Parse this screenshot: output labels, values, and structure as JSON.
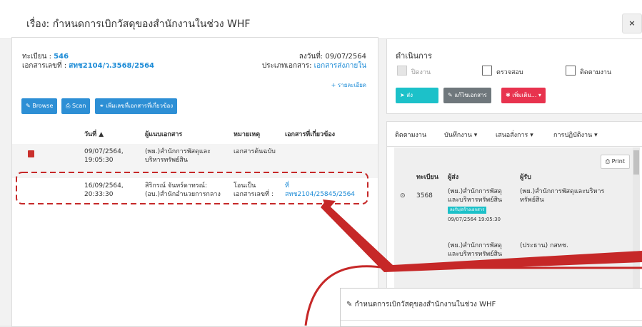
{
  "header": {
    "title": "เรื่อง: กำหนดการเบิกวัสดุของสำนักงานในช่วง WHF",
    "close_label": "×"
  },
  "doc": {
    "reg_label": "ทะเบียน :",
    "reg_value": "546",
    "docno_label": "เอกสารเลขที่ :",
    "docno_value": "สทช2104/ว.3568/2564",
    "date_label": "ลงวันที่:",
    "date_value": "09/07/2564",
    "type_label": "ประเภทเอกสาร:",
    "type_value": "เอกสารส่งภายใน",
    "detail_link": "+ รายละเอียด"
  },
  "attach_buttons": {
    "browse": "Browse",
    "scan": "Scan",
    "add_related": "เพิ่มเลขที่เอกสารที่เกี่ยวข้อง"
  },
  "table": {
    "headers": {
      "date": "วันที่",
      "attacher": "ผู้แนบเอกสาร",
      "note": "หมายเหตุ",
      "related": "เอกสารที่เกี่ยวข้อง"
    },
    "rows": [
      {
        "date": "09/07/2564,",
        "time": "19:05:30",
        "attacher1": "(พย.)สำนักการพัสดุและ",
        "attacher2": "บริหารทรัพย์สิน",
        "note1": "เอกสารต้นฉบับ",
        "note2": "",
        "related1": "",
        "related2": ""
      },
      {
        "date": "16/09/2564,",
        "time": "20:33:30",
        "attacher1": "สิริกรณ์ จันทร์ดาทรณ์:",
        "attacher2": "(อบ.)สำนักอำนวยการกลาง",
        "note1": "โอนเป็น",
        "note2": "เอกสารเลขที่ :",
        "related1": "ที่",
        "related2": "สทช2104/25845/2564"
      }
    ]
  },
  "actions": {
    "title": "ดำเนินการ",
    "checkboxes": [
      "ปิดงาน",
      "ตรวจสอบ",
      "ติดตามงาน"
    ],
    "send": "ส่ง",
    "edit_doc": "แก้ไขเอกสาร",
    "more": "เพิ่มเติม..."
  },
  "tabs": [
    "ติดตามงาน",
    "บันทึกงาน",
    "เสนอสั่งการ",
    "การปฏิบัติงาน"
  ],
  "history": {
    "print": "Print",
    "headers": {
      "reg": "ทะเบียน",
      "sender": "ผู้ส่ง",
      "receiver": "ผู้รับ"
    },
    "row1": {
      "reg": "3568",
      "sender1": "(พย.)สำนักการพัสดุ",
      "sender2": "และบริหารทรัพย์สิน",
      "badge": "ลงรับ/สร้างเอกสาร",
      "timestamp": "09/07/2564 19:05:30",
      "receiver1": "(พย.)สำนักการพัสดุและบริหาร",
      "receiver2": "ทรัพย์สิน"
    },
    "row2": {
      "sender1": "(พย.)สำนักการพัสดุ",
      "sender2": "และบริหารทรัพย์สิน",
      "receiver1": "(ประธาน) กสทช."
    }
  },
  "zoom": {
    "title": "กำหนดการเบิกวัสดุของสำนักงานในช่วง WHF"
  },
  "colors": {
    "accent": "#1a8ad6",
    "highlight": "#c62828",
    "cyan": "#1cc1c9",
    "red": "#e8334e"
  }
}
